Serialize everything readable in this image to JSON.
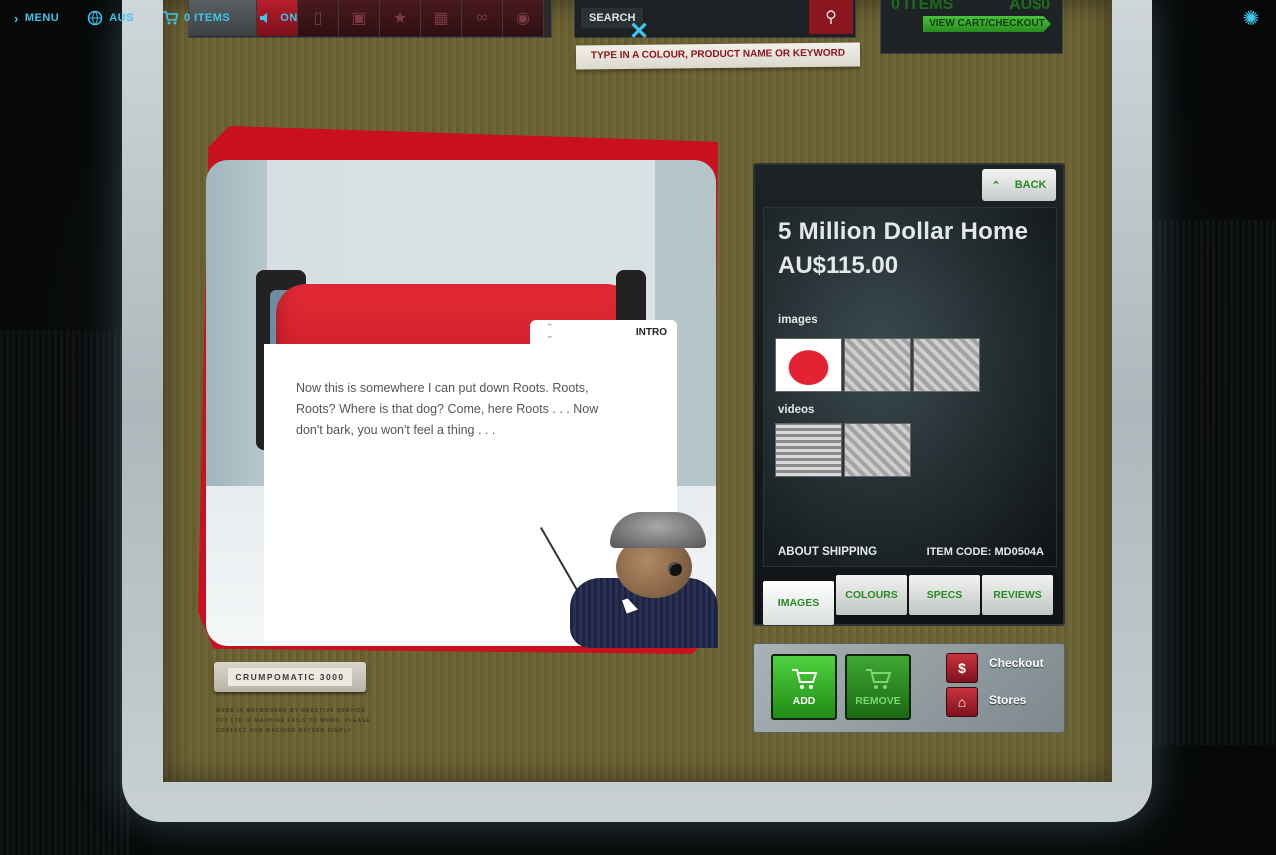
{
  "nav": {
    "menu_label": "MENU",
    "region_label": "AUS",
    "cart_label": "0 ITEMS",
    "sound_label": "ON"
  },
  "search": {
    "label": "SEARCH",
    "hint": "TYPE IN A COLOUR, PRODUCT NAME OR KEYWORD"
  },
  "cart_summary": {
    "items": "0 ITEMS",
    "total": "AU$0",
    "link": "VIEW CART/CHECKOUT"
  },
  "intro": {
    "tab_label": "INTRO",
    "text": "Now this is somewhere I can put down Roots. Roots, Roots? Where is that dog? Come, here Roots . . . Now don't bark, you won't feel a thing . . ."
  },
  "nameplate": {
    "label": "CRUMPOMATIC 3000",
    "fineprint": "MADE IN MELBOURNE BY REACTIVE SERVICE PTY LTD IF MACHINE FAILS TO WORK, PLEASE CONTACT OUR MACHINE RATHER SIMPLY"
  },
  "product": {
    "back_label": "BACK",
    "title": "5 Million Dollar Home",
    "price": "AU$115.00",
    "images_label": "images",
    "videos_label": "videos",
    "shipping_label": "ABOUT SHIPPING",
    "item_code": "ITEM CODE: MD0504A",
    "tabs": [
      "IMAGES",
      "COLOURS",
      "SPECS",
      "REVIEWS"
    ]
  },
  "actions": {
    "add_label": "ADD",
    "remove_label": "REMOVE",
    "checkout_label": "Checkout",
    "stores_label": "Stores",
    "checkout_icon": "$"
  },
  "colors": {
    "accent_cyan": "#3ec6ee",
    "brand_red": "#c8101e",
    "brand_green": "#2a8a22"
  }
}
